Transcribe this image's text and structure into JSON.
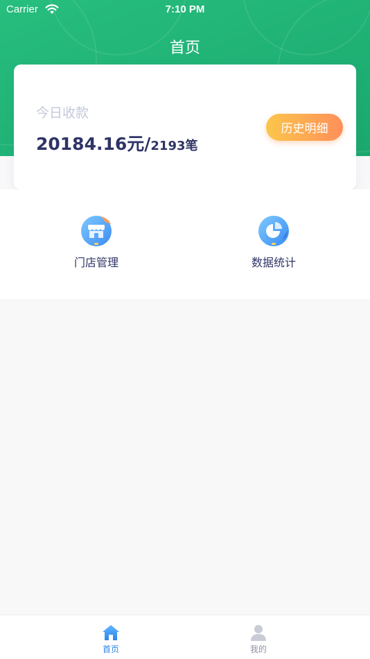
{
  "status_bar": {
    "carrier": "Carrier",
    "time": "7:10 PM"
  },
  "header": {
    "title": "首页"
  },
  "income_card": {
    "label": "今日收款",
    "amount": "20184.16元/",
    "count": "2193笔",
    "history_button": "历史明细"
  },
  "menu": {
    "items": [
      {
        "label": "门店管理",
        "icon": "storefront-icon"
      },
      {
        "label": "数据统计",
        "icon": "pie-chart-icon"
      }
    ]
  },
  "tab_bar": {
    "items": [
      {
        "label": "首页",
        "icon": "home-icon",
        "active": true
      },
      {
        "label": "我的",
        "icon": "user-icon",
        "active": false
      }
    ]
  },
  "colors": {
    "header_green": "#1fb274",
    "primary_text": "#2f3466",
    "muted_text": "#c3c8d9",
    "button_gradient_start": "#fbc64b",
    "button_gradient_end": "#ff8f5a",
    "active_tab": "#2e86e8",
    "inactive_tab": "#8e93a3"
  }
}
